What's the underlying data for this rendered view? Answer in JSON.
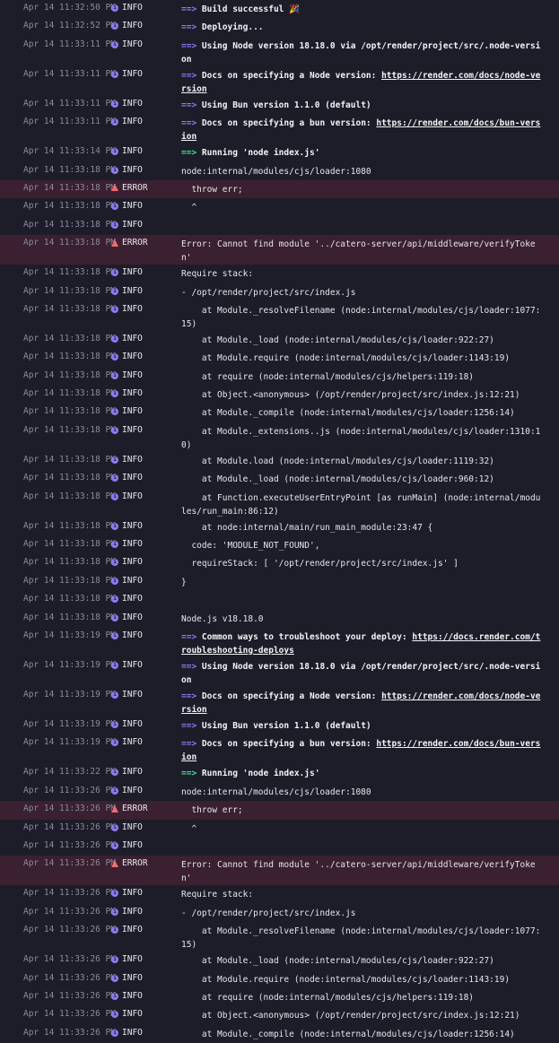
{
  "log": {
    "entries": [
      {
        "time": "Apr 14 11:32:50 PM",
        "level": "INFO",
        "arrow": "==> ",
        "text": "Build successful 🎉",
        "bold": true,
        "arrow_color": "purple"
      },
      {
        "time": "Apr 14 11:32:52 PM",
        "level": "INFO",
        "arrow": "==> ",
        "text": "Deploying...",
        "bold": true,
        "arrow_color": "purple"
      },
      {
        "time": "Apr 14 11:33:11 PM",
        "level": "INFO",
        "arrow": "==> ",
        "text": "Using Node version 18.18.0 via /opt/render/project/src/.node-version",
        "bold": true,
        "arrow_color": "purple"
      },
      {
        "time": "Apr 14 11:33:11 PM",
        "level": "INFO",
        "arrow": "==> ",
        "text": "Docs on specifying a Node version: ",
        "link": "https://render.com/docs/node-version",
        "bold": true,
        "arrow_color": "purple"
      },
      {
        "time": "Apr 14 11:33:11 PM",
        "level": "INFO",
        "arrow": "==> ",
        "text": "Using Bun version 1.1.0 (default)",
        "bold": true,
        "arrow_color": "purple"
      },
      {
        "time": "Apr 14 11:33:11 PM",
        "level": "INFO",
        "arrow": "==> ",
        "text": "Docs on specifying a bun version: ",
        "link": "https://render.com/docs/bun-version",
        "bold": true,
        "arrow_color": "purple"
      },
      {
        "time": "Apr 14 11:33:14 PM",
        "level": "INFO",
        "arrow": "==> ",
        "text": "Running 'node index.js'",
        "bold": true,
        "arrow_color": "green"
      },
      {
        "time": "Apr 14 11:33:18 PM",
        "level": "INFO",
        "text": "node:internal/modules/cjs/loader:1080"
      },
      {
        "time": "Apr 14 11:33:18 PM",
        "level": "ERROR",
        "text": "  throw err;"
      },
      {
        "time": "Apr 14 11:33:18 PM",
        "level": "INFO",
        "text": "  ^"
      },
      {
        "time": "Apr 14 11:33:18 PM",
        "level": "INFO",
        "text": ""
      },
      {
        "time": "Apr 14 11:33:18 PM",
        "level": "ERROR",
        "text": "Error: Cannot find module '../catero-server/api/middleware/verifyToken'"
      },
      {
        "time": "Apr 14 11:33:18 PM",
        "level": "INFO",
        "text": "Require stack:"
      },
      {
        "time": "Apr 14 11:33:18 PM",
        "level": "INFO",
        "text": "- /opt/render/project/src/index.js"
      },
      {
        "time": "Apr 14 11:33:18 PM",
        "level": "INFO",
        "text": "    at Module._resolveFilename (node:internal/modules/cjs/loader:1077:15)"
      },
      {
        "time": "Apr 14 11:33:18 PM",
        "level": "INFO",
        "text": "    at Module._load (node:internal/modules/cjs/loader:922:27)"
      },
      {
        "time": "Apr 14 11:33:18 PM",
        "level": "INFO",
        "text": "    at Module.require (node:internal/modules/cjs/loader:1143:19)"
      },
      {
        "time": "Apr 14 11:33:18 PM",
        "level": "INFO",
        "text": "    at require (node:internal/modules/cjs/helpers:119:18)"
      },
      {
        "time": "Apr 14 11:33:18 PM",
        "level": "INFO",
        "text": "    at Object.<anonymous> (/opt/render/project/src/index.js:12:21)"
      },
      {
        "time": "Apr 14 11:33:18 PM",
        "level": "INFO",
        "text": "    at Module._compile (node:internal/modules/cjs/loader:1256:14)"
      },
      {
        "time": "Apr 14 11:33:18 PM",
        "level": "INFO",
        "text": "    at Module._extensions..js (node:internal/modules/cjs/loader:1310:10)"
      },
      {
        "time": "Apr 14 11:33:18 PM",
        "level": "INFO",
        "text": "    at Module.load (node:internal/modules/cjs/loader:1119:32)"
      },
      {
        "time": "Apr 14 11:33:18 PM",
        "level": "INFO",
        "text": "    at Module._load (node:internal/modules/cjs/loader:960:12)"
      },
      {
        "time": "Apr 14 11:33:18 PM",
        "level": "INFO",
        "text": "    at Function.executeUserEntryPoint [as runMain] (node:internal/modules/run_main:86:12)"
      },
      {
        "time": "Apr 14 11:33:18 PM",
        "level": "INFO",
        "text": "    at node:internal/main/run_main_module:23:47 {"
      },
      {
        "time": "Apr 14 11:33:18 PM",
        "level": "INFO",
        "text": "  code: 'MODULE_NOT_FOUND',"
      },
      {
        "time": "Apr 14 11:33:18 PM",
        "level": "INFO",
        "text": "  requireStack: [ '/opt/render/project/src/index.js' ]"
      },
      {
        "time": "Apr 14 11:33:18 PM",
        "level": "INFO",
        "text": "}"
      },
      {
        "time": "Apr 14 11:33:18 PM",
        "level": "INFO",
        "text": ""
      },
      {
        "time": "Apr 14 11:33:18 PM",
        "level": "INFO",
        "text": "Node.js v18.18.0"
      },
      {
        "time": "Apr 14 11:33:19 PM",
        "level": "INFO",
        "arrow": "==> ",
        "text": "Common ways to troubleshoot your deploy: ",
        "link": "https://docs.render.com/troubleshooting-deploys",
        "bold": true,
        "arrow_color": "purple"
      },
      {
        "time": "Apr 14 11:33:19 PM",
        "level": "INFO",
        "arrow": "==> ",
        "text": "Using Node version 18.18.0 via /opt/render/project/src/.node-version",
        "bold": true,
        "arrow_color": "purple"
      },
      {
        "time": "Apr 14 11:33:19 PM",
        "level": "INFO",
        "arrow": "==> ",
        "text": "Docs on specifying a Node version: ",
        "link": "https://render.com/docs/node-version",
        "bold": true,
        "arrow_color": "purple"
      },
      {
        "time": "Apr 14 11:33:19 PM",
        "level": "INFO",
        "arrow": "==> ",
        "text": "Using Bun version 1.1.0 (default)",
        "bold": true,
        "arrow_color": "purple"
      },
      {
        "time": "Apr 14 11:33:19 PM",
        "level": "INFO",
        "arrow": "==> ",
        "text": "Docs on specifying a bun version: ",
        "link": "https://render.com/docs/bun-version",
        "bold": true,
        "arrow_color": "purple"
      },
      {
        "time": "Apr 14 11:33:22 PM",
        "level": "INFO",
        "arrow": "==> ",
        "text": "Running 'node index.js'",
        "bold": true,
        "arrow_color": "green"
      },
      {
        "time": "Apr 14 11:33:26 PM",
        "level": "INFO",
        "text": "node:internal/modules/cjs/loader:1080"
      },
      {
        "time": "Apr 14 11:33:26 PM",
        "level": "ERROR",
        "text": "  throw err;"
      },
      {
        "time": "Apr 14 11:33:26 PM",
        "level": "INFO",
        "text": "  ^"
      },
      {
        "time": "Apr 14 11:33:26 PM",
        "level": "INFO",
        "text": ""
      },
      {
        "time": "Apr 14 11:33:26 PM",
        "level": "ERROR",
        "text": "Error: Cannot find module '../catero-server/api/middleware/verifyToken'"
      },
      {
        "time": "Apr 14 11:33:26 PM",
        "level": "INFO",
        "text": "Require stack:"
      },
      {
        "time": "Apr 14 11:33:26 PM",
        "level": "INFO",
        "text": "- /opt/render/project/src/index.js"
      },
      {
        "time": "Apr 14 11:33:26 PM",
        "level": "INFO",
        "text": "    at Module._resolveFilename (node:internal/modules/cjs/loader:1077:15)"
      },
      {
        "time": "Apr 14 11:33:26 PM",
        "level": "INFO",
        "text": "    at Module._load (node:internal/modules/cjs/loader:922:27)"
      },
      {
        "time": "Apr 14 11:33:26 PM",
        "level": "INFO",
        "text": "    at Module.require (node:internal/modules/cjs/loader:1143:19)"
      },
      {
        "time": "Apr 14 11:33:26 PM",
        "level": "INFO",
        "text": "    at require (node:internal/modules/cjs/helpers:119:18)"
      },
      {
        "time": "Apr 14 11:33:26 PM",
        "level": "INFO",
        "text": "    at Object.<anonymous> (/opt/render/project/src/index.js:12:21)"
      },
      {
        "time": "Apr 14 11:33:26 PM",
        "level": "INFO",
        "text": "    at Module._compile (node:internal/modules/cjs/loader:1256:14)"
      }
    ]
  }
}
